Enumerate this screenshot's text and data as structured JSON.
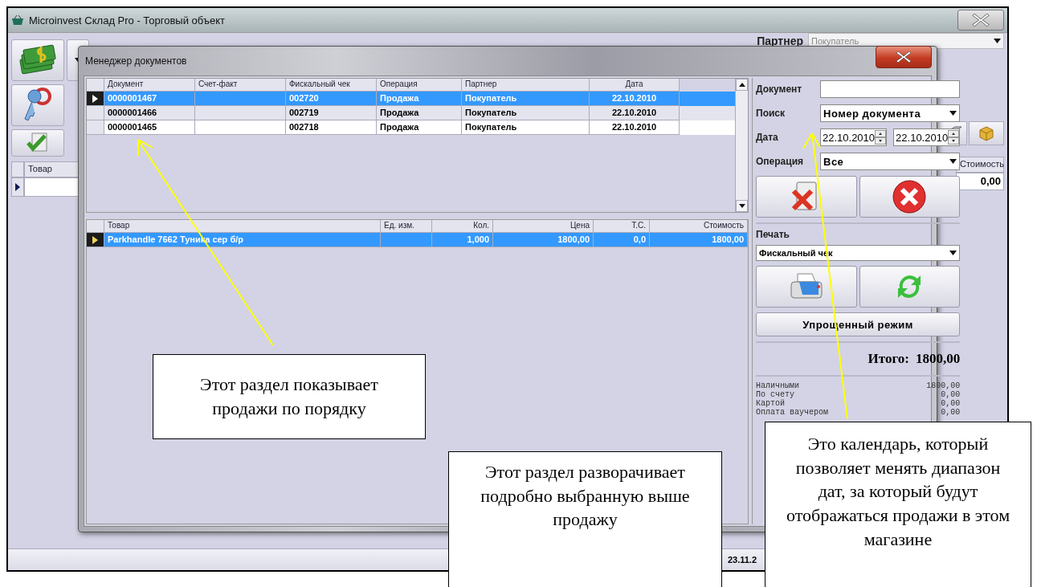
{
  "app_window": {
    "title": "Microinvest Склад Pro - Торговый объект",
    "partner_label": "Партнер",
    "partner_value": "Покупатель",
    "grid_columns": [
      "Товар",
      "Стоимость"
    ],
    "grid_total": "0,00",
    "status_date": "23.11.2"
  },
  "dialog": {
    "title": "Менеджер документов",
    "documents": {
      "columns": [
        "Документ",
        "Счет-факт",
        "Фискальный чек",
        "Операция",
        "Партнер",
        "Дата"
      ],
      "rows": [
        {
          "cells": [
            "0000001467",
            "",
            "002720",
            "Продажа",
            "Покупатель",
            "22.10.2010"
          ],
          "selected": true
        },
        {
          "cells": [
            "0000001466",
            "",
            "002719",
            "Продажа",
            "Покупатель",
            "22.10.2010"
          ],
          "selected": false
        },
        {
          "cells": [
            "0000001465",
            "",
            "002718",
            "Продажа",
            "Покупатель",
            "22.10.2010"
          ],
          "selected": false
        }
      ]
    },
    "items": {
      "columns": [
        "Товар",
        "Ед. изм.",
        "Кол.",
        "Цена",
        "Т.С.",
        "Стоимость"
      ],
      "rows": [
        {
          "cells": [
            "Parkhandle 7662 Туника сер б/р",
            "",
            "1,000",
            "1800,00",
            "0,0",
            "1800,00"
          ],
          "selected": true
        }
      ]
    },
    "filters": {
      "document_label": "Документ",
      "search_label": "Поиск",
      "search_value": "Номер документа",
      "date_label": "Дата",
      "date_from": "22.10.2010",
      "date_to": "22.10.2010",
      "operation_label": "Операция",
      "operation_value": "Все"
    },
    "print": {
      "label": "Печать",
      "value": "Фискальный чек"
    },
    "simple_mode_button": "Упрощенный режим",
    "total": {
      "label": "Итого:",
      "value": "1800,00"
    },
    "payments": [
      {
        "label": "Наличными",
        "value": "1800,00"
      },
      {
        "label": "По счету",
        "value": "0,00"
      },
      {
        "label": "Картой",
        "value": "0,00"
      },
      {
        "label": "Оплата ваучером",
        "value": "0,00"
      }
    ]
  },
  "callouts": [
    {
      "text": "Этот раздел показывает продажи по порядку"
    },
    {
      "text": "Этот раздел разворачивает подробно выбранную выше продажу"
    },
    {
      "text": "Это календарь, который позволяет менять диапазон дат, за который будут отображаться продажи в этом магазине"
    }
  ]
}
